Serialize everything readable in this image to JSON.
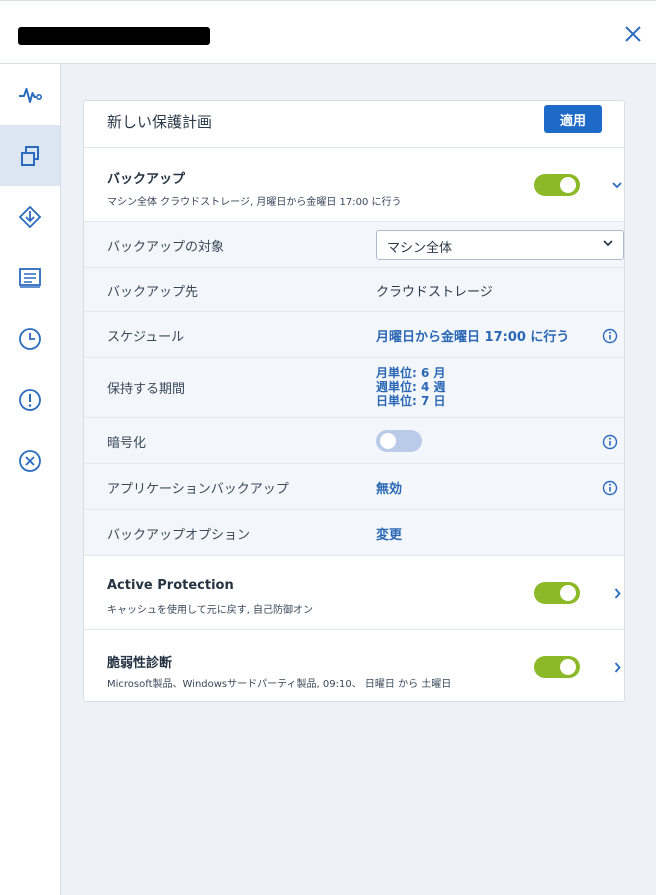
{
  "header": {
    "close_icon": "close-icon"
  },
  "sidebar": {
    "items": [
      {
        "icon": "activity-icon"
      },
      {
        "icon": "plans-icon"
      },
      {
        "icon": "recovery-icon"
      },
      {
        "icon": "report-icon"
      },
      {
        "icon": "clock-icon"
      },
      {
        "icon": "alert-icon"
      },
      {
        "icon": "cancel-circle-icon"
      }
    ],
    "active_index": 1
  },
  "plan": {
    "title": "新しい保護計画",
    "apply_label": "適用"
  },
  "backup": {
    "title": "バックアップ",
    "subtitle": "マシン全体 クラウドストレージ, 月曜日から金曜日 17:00 に行う",
    "enabled": true,
    "rows": {
      "target_label": "バックアップの対象",
      "target_value": "マシン全体",
      "destination_label": "バックアップ先",
      "destination_value": "クラウドストレージ",
      "schedule_label": "スケジュール",
      "schedule_value": "月曜日から金曜日 17:00 に行う",
      "retention_label": "保持する期間",
      "retention_monthly": "月単位: 6 月",
      "retention_weekly": "週単位: 4 週",
      "retention_daily": "日単位: 7 日",
      "encryption_label": "暗号化",
      "encryption_enabled": false,
      "app_backup_label": "アプリケーションバックアップ",
      "app_backup_value": "無効",
      "options_label": "バックアップオプション",
      "options_value": "変更"
    }
  },
  "active_protection": {
    "title": "Active Protection",
    "subtitle": "キャッシュを使用して元に戻す, 自己防御オン",
    "enabled": true
  },
  "vulnerability": {
    "title": "脆弱性診断",
    "subtitle": "Microsoft製品、Windowsサードパーティ製品, 09:10、 日曜日 から 土曜日",
    "enabled": true
  },
  "colors": {
    "accent": "#1e6ac9",
    "toggle_on": "#8cb928",
    "toggle_off": "#b9cbe8",
    "link": "#2a68b5"
  }
}
